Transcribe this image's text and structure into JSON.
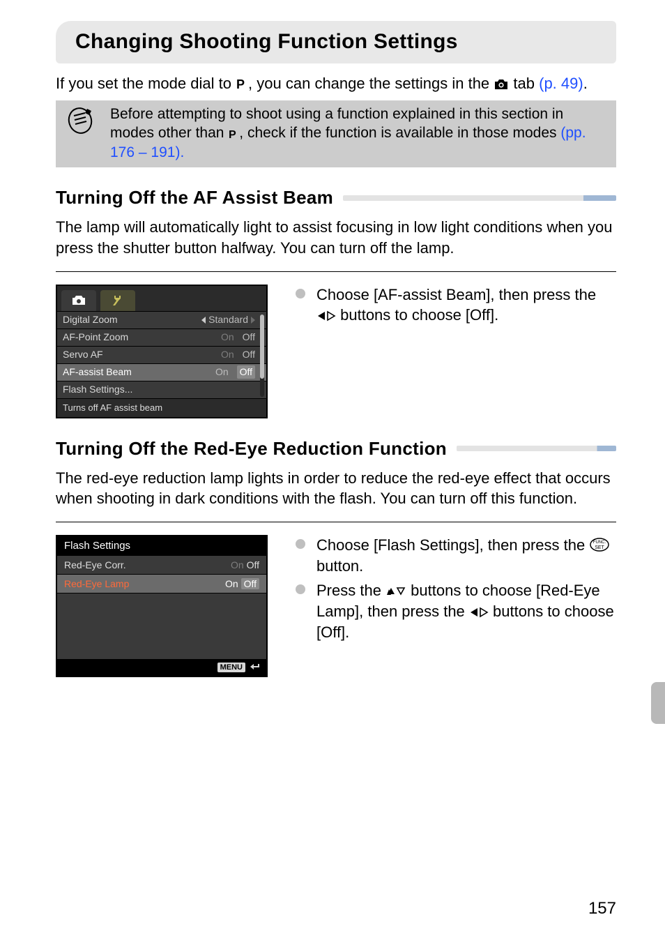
{
  "title": "Changing Shooting Function Settings",
  "intro": {
    "pre": "If you set the mode dial to ",
    "mid": ", you can change the settings in the ",
    "post": " tab ",
    "pageref": "(p. 49)",
    "period": "."
  },
  "note": {
    "line1_pre": "Before attempting to shoot using a function explained in this section in modes other than ",
    "line1_post": ", check if the function is available in those modes ",
    "pp_open": "(pp. ",
    "pp_a": "176",
    "pp_sep": " – ",
    "pp_b": "191",
    "pp_close": ")."
  },
  "sections": {
    "af": {
      "heading": "Turning Off the AF Assist Beam",
      "body": "The lamp will automatically light to assist focusing in low light conditions when you press the shutter button halfway. You can turn off the lamp.",
      "step1_pre": "Choose [AF-assist Beam], then press the ",
      "step1_post": " buttons to choose [Off]."
    },
    "redeye": {
      "heading": "Turning Off the Red-Eye Reduction Function",
      "body": "The red-eye reduction lamp lights in order to reduce the red-eye effect that occurs when shooting in dark conditions with the flash. You can turn off this function.",
      "step1_pre": "Choose [Flash Settings], then press the ",
      "step1_post": " button.",
      "step2_pre": "Press the ",
      "step2_mid": " buttons to choose [Red-Eye Lamp], then press the ",
      "step2_post": " buttons to choose [Off]."
    }
  },
  "lcd1": {
    "rows": [
      {
        "label": "Digital Zoom",
        "kind": "arrow",
        "value": "Standard"
      },
      {
        "label": "AF-Point Zoom",
        "kind": "onoff",
        "on": "On",
        "off": "Off",
        "selected": "Off",
        "highlight": false
      },
      {
        "label": "Servo AF",
        "kind": "onoff",
        "on": "On",
        "off": "Off",
        "selected": "Off",
        "highlight": false
      },
      {
        "label": "AF-assist Beam",
        "kind": "onoff",
        "on": "On",
        "off": "Off",
        "selected": "Off",
        "highlight": true
      },
      {
        "label": "Flash Settings...",
        "kind": "submenu"
      }
    ],
    "help": "Turns off AF assist beam"
  },
  "lcd2": {
    "title": "Flash Settings",
    "rows": [
      {
        "label": "Red-Eye Corr.",
        "on": "On",
        "off": "Off",
        "selected": "Off",
        "highlight": false
      },
      {
        "label": "Red-Eye Lamp",
        "on": "On",
        "off": "Off",
        "selected": "Off",
        "highlight": true
      }
    ],
    "menu": "MENU"
  },
  "labels": {
    "P": "P",
    "funcset_top": "FUNC.",
    "funcset_bot": "SET"
  },
  "page_number": "157"
}
